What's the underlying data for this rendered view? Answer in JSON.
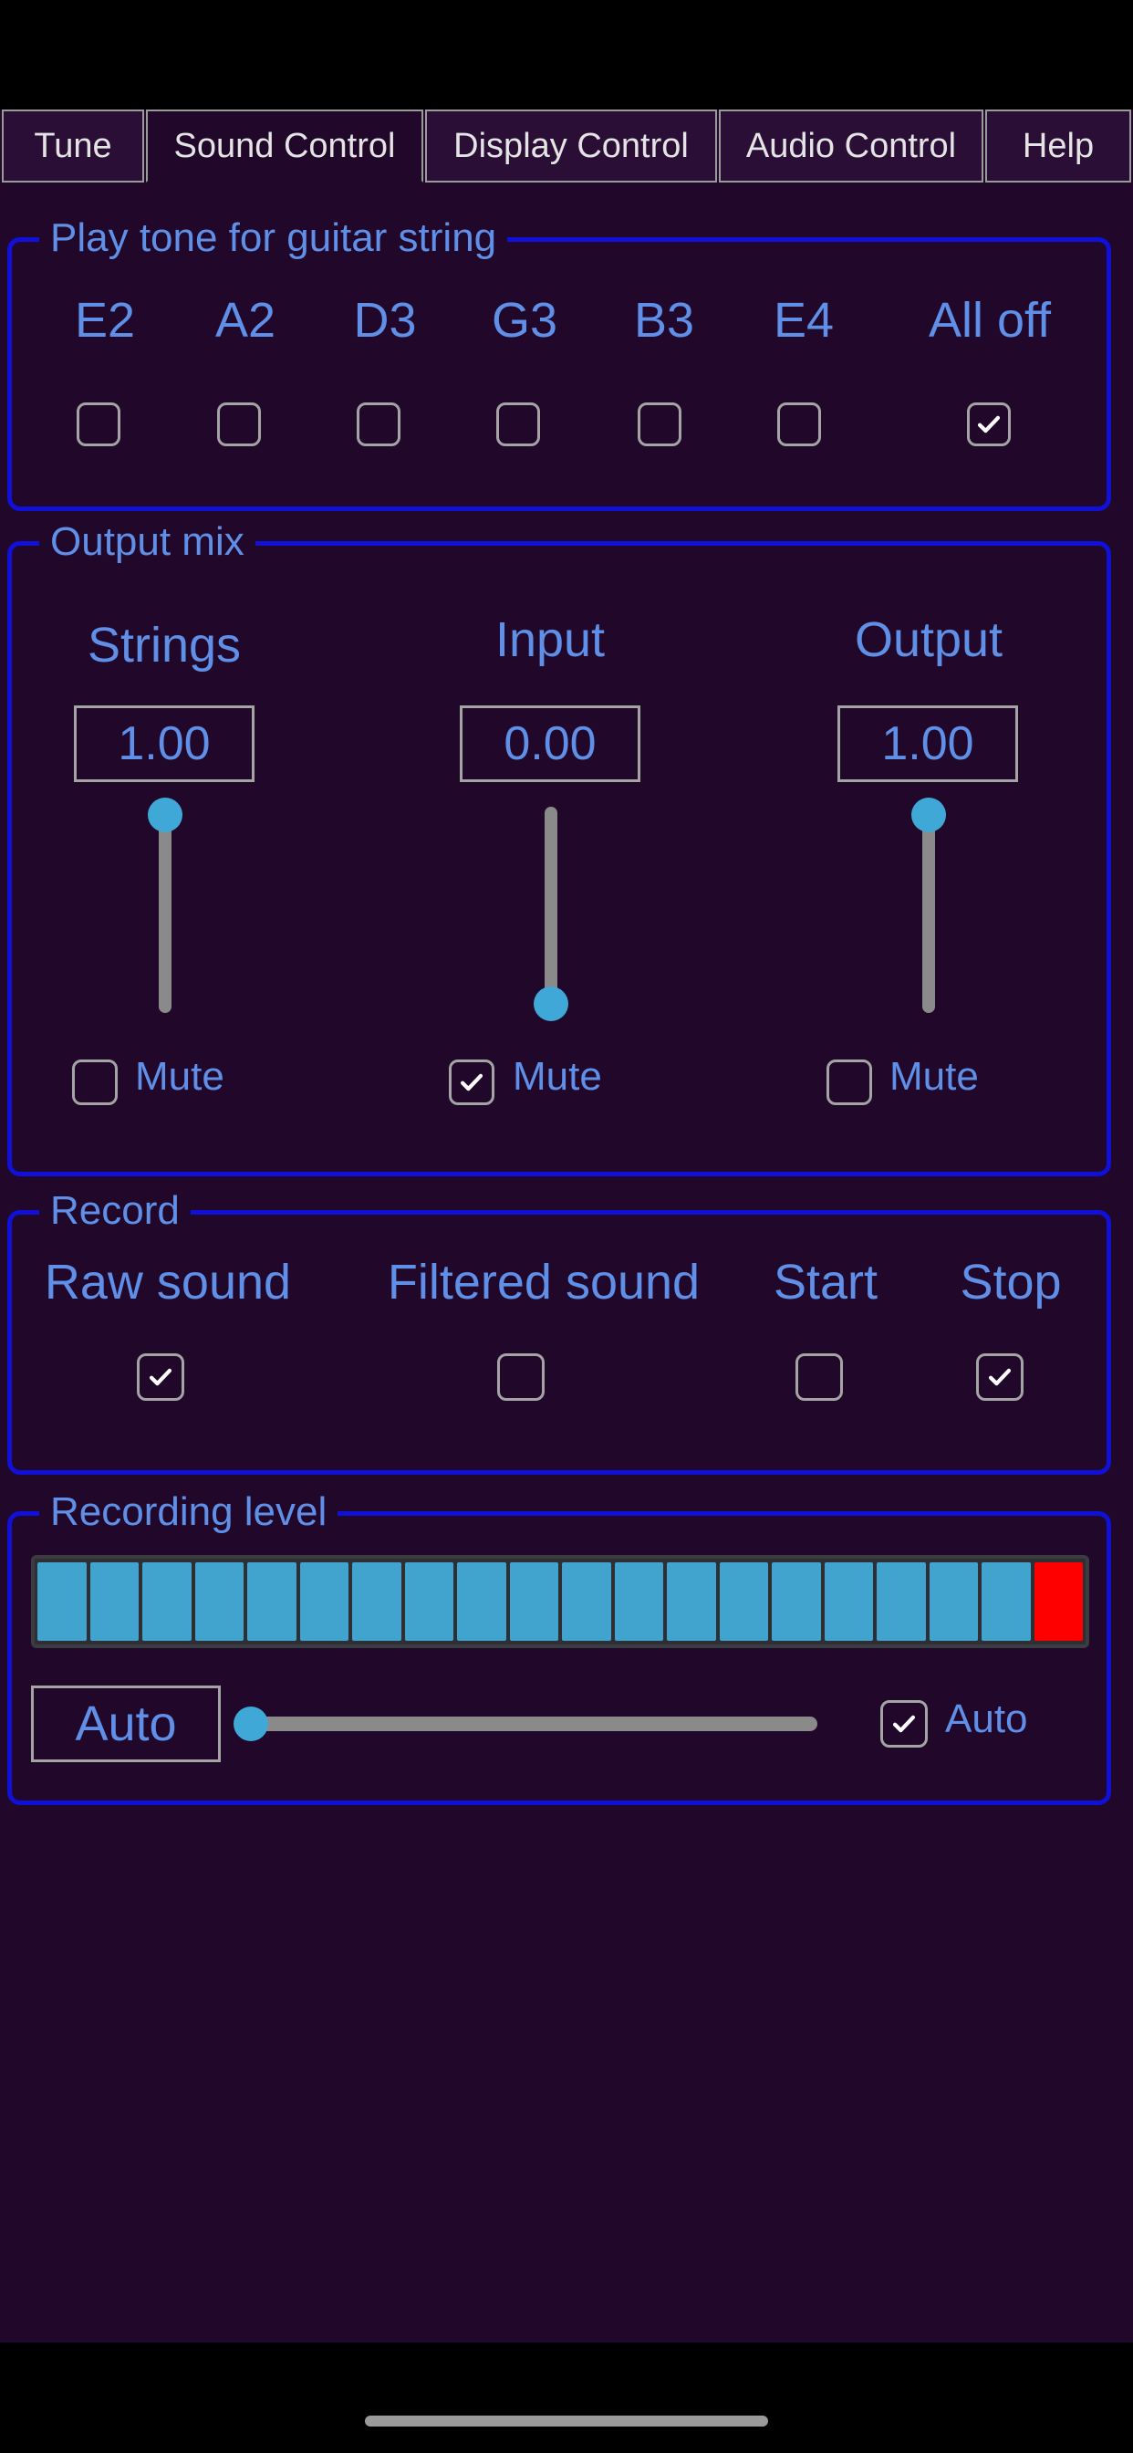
{
  "tabs": [
    "Tune",
    "Sound Control",
    "Display Control",
    "Audio Control",
    "Help"
  ],
  "active_tab": "Sound Control",
  "play_tone": {
    "legend": "Play tone for guitar string",
    "strings": [
      {
        "label": "E2",
        "checked": false
      },
      {
        "label": "A2",
        "checked": false
      },
      {
        "label": "D3",
        "checked": false
      },
      {
        "label": "G3",
        "checked": false
      },
      {
        "label": "B3",
        "checked": false
      },
      {
        "label": "E4",
        "checked": false
      },
      {
        "label": "All off",
        "checked": true
      }
    ]
  },
  "output_mix": {
    "legend": "Output mix",
    "channels": [
      {
        "label": "Strings",
        "value": "1.00",
        "level": 1.0,
        "mute_label": "Mute",
        "muted": false
      },
      {
        "label": "Input",
        "value": "0.00",
        "level": 0.0,
        "mute_label": "Mute",
        "muted": true
      },
      {
        "label": "Output",
        "value": "1.00",
        "level": 1.0,
        "mute_label": "Mute",
        "muted": false
      }
    ]
  },
  "record": {
    "legend": "Record",
    "options": [
      {
        "label": "Raw sound",
        "checked": true
      },
      {
        "label": "Filtered sound",
        "checked": false
      },
      {
        "label": "Start",
        "checked": false
      },
      {
        "label": "Stop",
        "checked": true
      }
    ]
  },
  "recording_level": {
    "legend": "Recording level",
    "meter_segments_blue": 19,
    "meter_segments_red": 1,
    "value_box": "Auto",
    "slider_level": 0.0,
    "auto_label": "Auto",
    "auto_checked": true
  },
  "colors": {
    "background": "#21082b",
    "group_border": "#1010d8",
    "label_text": "#5f8fe6",
    "accent": "#3fa8d6",
    "meter_peak": "#ff0000"
  }
}
